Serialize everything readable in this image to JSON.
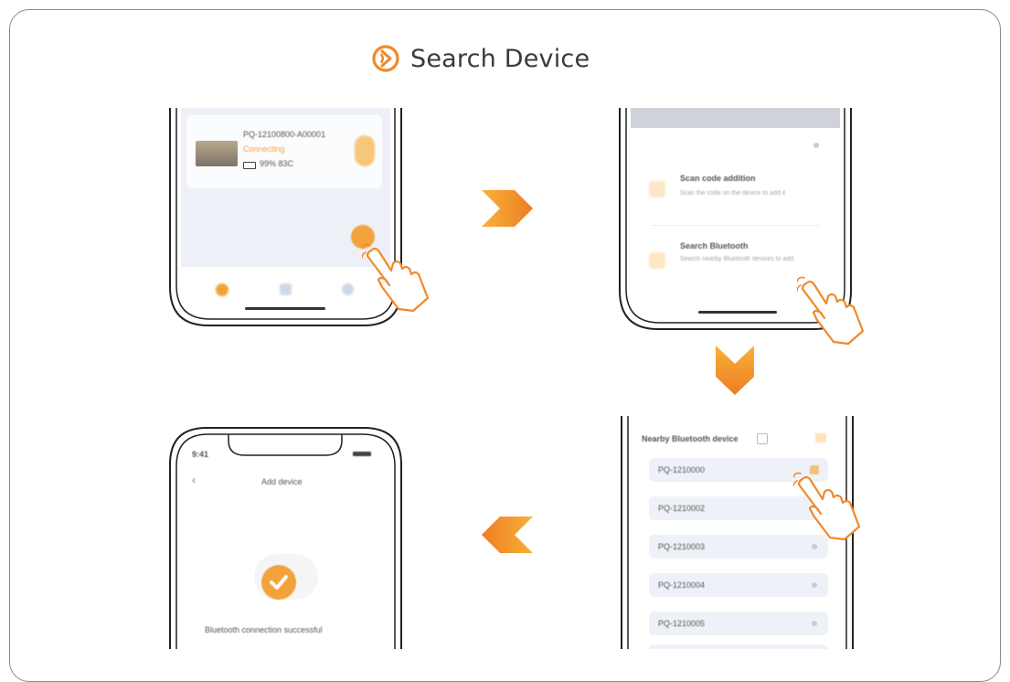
{
  "header": {
    "title": "Search Device",
    "icon": "bluetooth-search-icon",
    "accent": "#f2a23a"
  },
  "step1": {
    "device_name": "PQ-12100800-A00001",
    "device_status": "Connecting",
    "device_spec": "99% 83C"
  },
  "step2": {
    "option1_title": "Scan code addition",
    "option1_desc": "Scan the code on the device to add it",
    "option2_title": "Search Bluetooth",
    "option2_desc": "Search nearby Bluetooth devices to add"
  },
  "step3": {
    "list_title": "Nearby Bluetooth device",
    "devices": [
      "PQ-1210000",
      "PQ-1210002",
      "PQ-1210003",
      "PQ-1210004",
      "PQ-1210005"
    ]
  },
  "step4": {
    "time": "9:41",
    "page_title": "Add device",
    "message": "Bluetooth connection successful"
  }
}
